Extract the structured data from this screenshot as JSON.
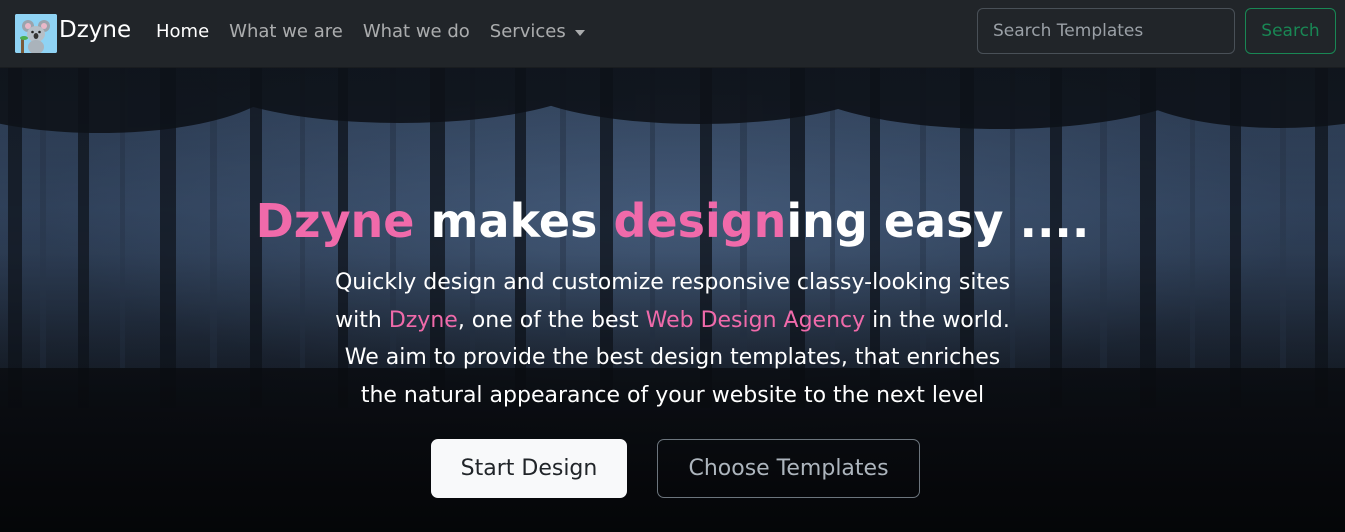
{
  "brand": {
    "name": "Dzyne",
    "logo_icon": "koala-logo-icon"
  },
  "nav": {
    "items": [
      {
        "label": "Home",
        "active": true
      },
      {
        "label": "What we are",
        "active": false
      },
      {
        "label": "What we do",
        "active": false
      },
      {
        "label": "Services",
        "active": false,
        "dropdown": true
      }
    ]
  },
  "search": {
    "placeholder": "Search Templates",
    "value": "",
    "button_label": "Search"
  },
  "hero": {
    "headline": {
      "part1": "Dzyne",
      "part2": " makes ",
      "part3": "design",
      "part4": "ing easy ...."
    },
    "subtext": {
      "line1": "Quickly design and customize responsive classy-looking sites",
      "line2_a": "with ",
      "line2_b": "Dzyne",
      "line2_c": ", one of the best ",
      "line2_d": "Web Design Agency",
      "line2_e": " in the world.",
      "line3": "We aim to provide the best design templates, that enriches",
      "line4": "the natural appearance of your website to the next level"
    },
    "primary_button": "Start Design",
    "secondary_button": "Choose Templates"
  },
  "colors": {
    "accent_pink": "#f06aaa",
    "navbar_bg": "#212529",
    "search_green": "#198754"
  }
}
